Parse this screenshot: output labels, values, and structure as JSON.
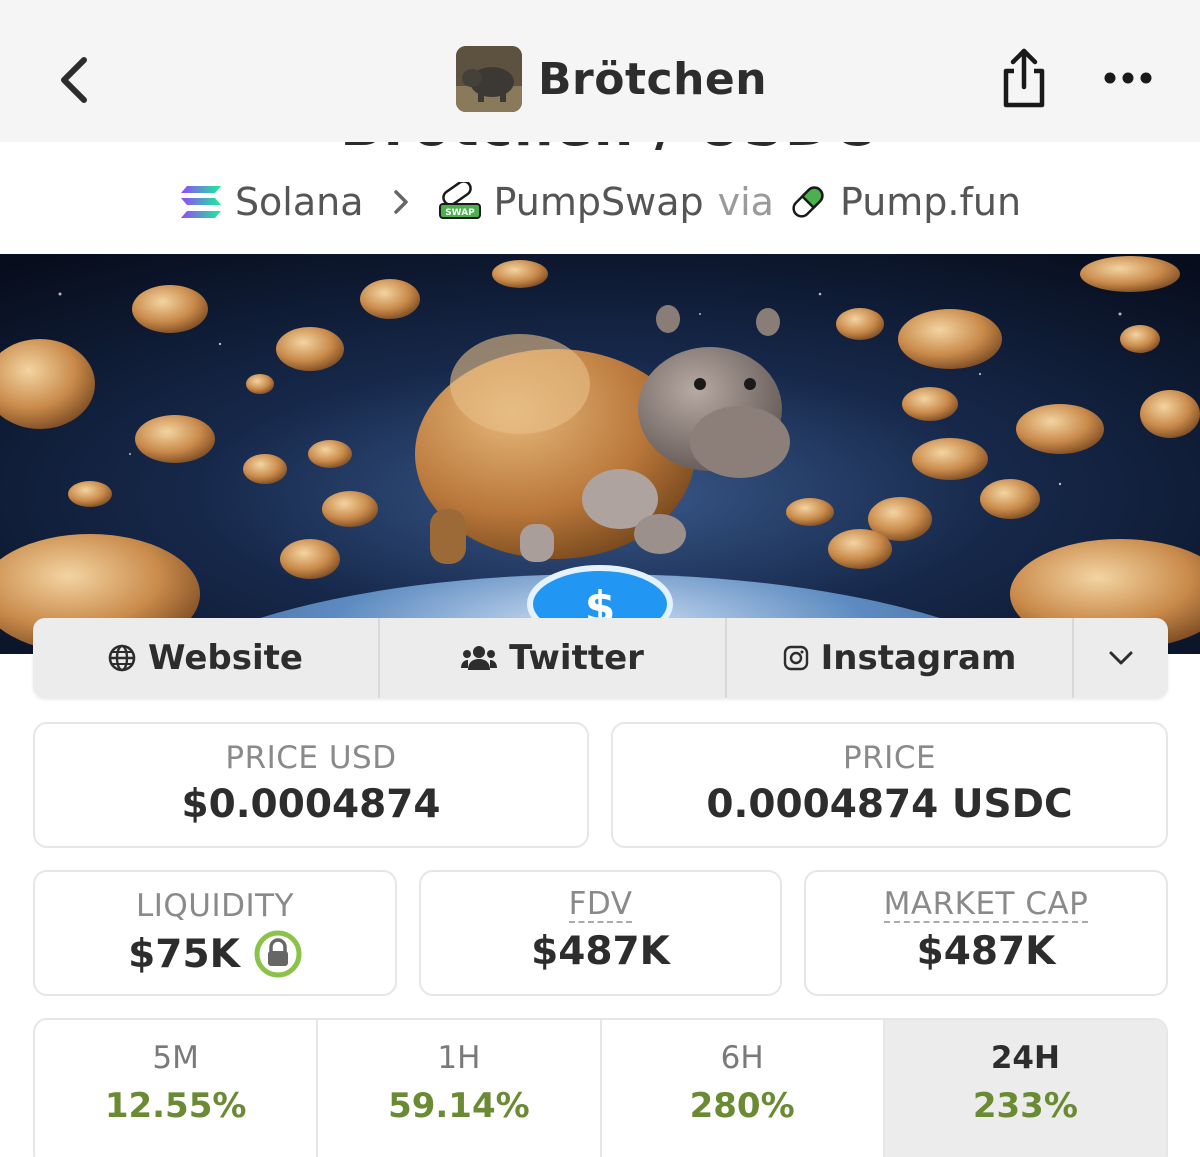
{
  "header": {
    "title": "Brötchen",
    "back_icon": "chevron-left-icon",
    "share_icon": "share-icon",
    "more_icon": "more-horizontal-icon"
  },
  "pair": {
    "partial_title": "Brötchen / USDC"
  },
  "chain_row": {
    "chain": "Solana",
    "dex": "PumpSwap",
    "via": "via",
    "launchpad": "Pump.fun"
  },
  "links": {
    "website": "Website",
    "twitter": "Twitter",
    "instagram": "Instagram"
  },
  "stats": {
    "price_usd_label": "PRICE USD",
    "price_usd_value": "$0.0004874",
    "price_label": "PRICE",
    "price_value": "0.0004874 USDC",
    "liquidity_label": "LIQUIDITY",
    "liquidity_value": "$75K",
    "fdv_label": "FDV",
    "fdv_value": "$487K",
    "mcap_label": "MARKET CAP",
    "mcap_value": "$487K"
  },
  "changes": [
    {
      "period": "5M",
      "pct": "12.55%"
    },
    {
      "period": "1H",
      "pct": "59.14%"
    },
    {
      "period": "6H",
      "pct": "280%"
    },
    {
      "period": "24H",
      "pct": "233%"
    }
  ],
  "colors": {
    "positive": "#6a8a34",
    "lock_ring": "#8bc34a",
    "solana_a": "#9945ff",
    "solana_b": "#14f195"
  }
}
